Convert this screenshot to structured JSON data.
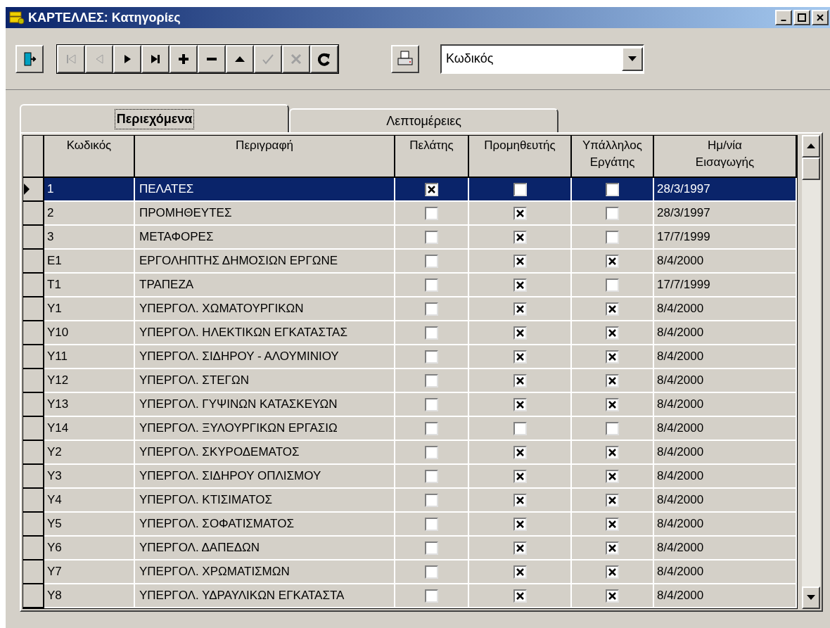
{
  "window": {
    "title": "ΚΑΡΤΕΛΛΕΣ: Κατηγορίες"
  },
  "toolbar": [
    {
      "kind": "exit"
    },
    {
      "kind": "first",
      "disabled": true
    },
    {
      "kind": "prev",
      "disabled": true
    },
    {
      "kind": "next",
      "disabled": false
    },
    {
      "kind": "last",
      "disabled": false
    },
    {
      "kind": "add",
      "disabled": false
    },
    {
      "kind": "delete",
      "disabled": false
    },
    {
      "kind": "edit",
      "disabled": false
    },
    {
      "kind": "post",
      "disabled": true
    },
    {
      "kind": "cancel",
      "disabled": true
    },
    {
      "kind": "refresh",
      "disabled": false
    },
    {
      "kind": "print"
    }
  ],
  "sort_select": {
    "value": "Κωδικός"
  },
  "tabs": [
    {
      "label": "Περιεχόμενα",
      "selected": true
    },
    {
      "label": "Λεπτομέρειες",
      "selected": false
    }
  ],
  "table": {
    "columns": [
      "Κωδικός",
      "Περιγραφή",
      "Πελάτης",
      "Προμηθευτής",
      "Υπάλληλος Εργάτης",
      "Ημ/νία Εισαγωγής"
    ],
    "rows": [
      {
        "code": "1",
        "description": "ΠΕΛΑΤΕΣ",
        "customer": true,
        "supplier": false,
        "employee": false,
        "date": "28/3/1997",
        "selected": true
      },
      {
        "code": "2",
        "description": "ΠΡΟΜΗΘΕΥΤΕΣ",
        "customer": false,
        "supplier": true,
        "employee": false,
        "date": "28/3/1997",
        "selected": false
      },
      {
        "code": "3",
        "description": "ΜΕΤΑΦΟΡΕΣ",
        "customer": false,
        "supplier": true,
        "employee": false,
        "date": "17/7/1999",
        "selected": false
      },
      {
        "code": "Ε1",
        "description": "ΕΡΓΟΛΗΠΤΗΣ ΔΗΜΟΣΙΩΝ ΕΡΓΩΝΕ",
        "customer": false,
        "supplier": true,
        "employee": true,
        "date": "8/4/2000",
        "selected": false
      },
      {
        "code": "Τ1",
        "description": "ΤΡΑΠΕΖΑ",
        "customer": false,
        "supplier": true,
        "employee": false,
        "date": "17/7/1999",
        "selected": false
      },
      {
        "code": "Υ1",
        "description": "ΥΠΕΡΓΟΛ. ΧΩΜΑΤΟΥΡΓΙΚΩΝ",
        "customer": false,
        "supplier": true,
        "employee": true,
        "date": "8/4/2000",
        "selected": false
      },
      {
        "code": "Υ10",
        "description": "ΥΠΕΡΓΟΛ. ΗΛΕΚΤΙΚΩΝ ΕΓΚΑΤΑΣΤΑΣ",
        "customer": false,
        "supplier": true,
        "employee": true,
        "date": "8/4/2000",
        "selected": false
      },
      {
        "code": "Υ11",
        "description": "ΥΠΕΡΓΟΛ. ΣΙΔΗΡΟΥ - ΑΛΟΥΜΙΝΙΟΥ",
        "customer": false,
        "supplier": true,
        "employee": true,
        "date": "8/4/2000",
        "selected": false
      },
      {
        "code": "Υ12",
        "description": "ΥΠΕΡΓΟΛ. ΣΤΕΓΩΝ",
        "customer": false,
        "supplier": true,
        "employee": true,
        "date": "8/4/2000",
        "selected": false
      },
      {
        "code": "Υ13",
        "description": "ΥΠΕΡΓΟΛ. ΓΥΨΙΝΩΝ ΚΑΤΑΣΚΕΥΩΝ",
        "customer": false,
        "supplier": true,
        "employee": true,
        "date": "8/4/2000",
        "selected": false
      },
      {
        "code": "Υ14",
        "description": "ΥΠΕΡΓΟΛ. ΞΥΛΟΥΡΓΙΚΩΝ ΕΡΓΑΣΙΩ",
        "customer": false,
        "supplier": false,
        "employee": false,
        "date": "8/4/2000",
        "selected": false
      },
      {
        "code": "Υ2",
        "description": "ΥΠΕΡΓΟΛ. ΣΚΥΡΟΔΕΜΑΤΟΣ",
        "customer": false,
        "supplier": true,
        "employee": true,
        "date": "8/4/2000",
        "selected": false
      },
      {
        "code": "Υ3",
        "description": "ΥΠΕΡΓΟΛ. ΣΙΔΗΡΟΥ ΟΠΛΙΣΜΟΥ",
        "customer": false,
        "supplier": true,
        "employee": true,
        "date": "8/4/2000",
        "selected": false
      },
      {
        "code": "Υ4",
        "description": "ΥΠΕΡΓΟΛ. ΚΤΙΣΙΜΑΤΟΣ",
        "customer": false,
        "supplier": true,
        "employee": true,
        "date": "8/4/2000",
        "selected": false
      },
      {
        "code": "Υ5",
        "description": "ΥΠΕΡΓΟΛ. ΣΟΦΑΤΙΣΜΑΤΟΣ",
        "customer": false,
        "supplier": true,
        "employee": true,
        "date": "8/4/2000",
        "selected": false
      },
      {
        "code": "Υ6",
        "description": "ΥΠΕΡΓΟΛ. ΔΑΠΕΔΩΝ",
        "customer": false,
        "supplier": true,
        "employee": true,
        "date": "8/4/2000",
        "selected": false
      },
      {
        "code": "Υ7",
        "description": "ΥΠΕΡΓΟΛ. ΧΡΩΜΑΤΙΣΜΩΝ",
        "customer": false,
        "supplier": true,
        "employee": true,
        "date": "8/4/2000",
        "selected": false
      },
      {
        "code": "Υ8",
        "description": "ΥΠΕΡΓΟΛ. ΥΔΡΑΥΛΙΚΩΝ ΕΓΚΑΤΑΣΤΑ",
        "customer": false,
        "supplier": true,
        "employee": true,
        "date": "8/4/2000",
        "selected": false
      }
    ]
  }
}
